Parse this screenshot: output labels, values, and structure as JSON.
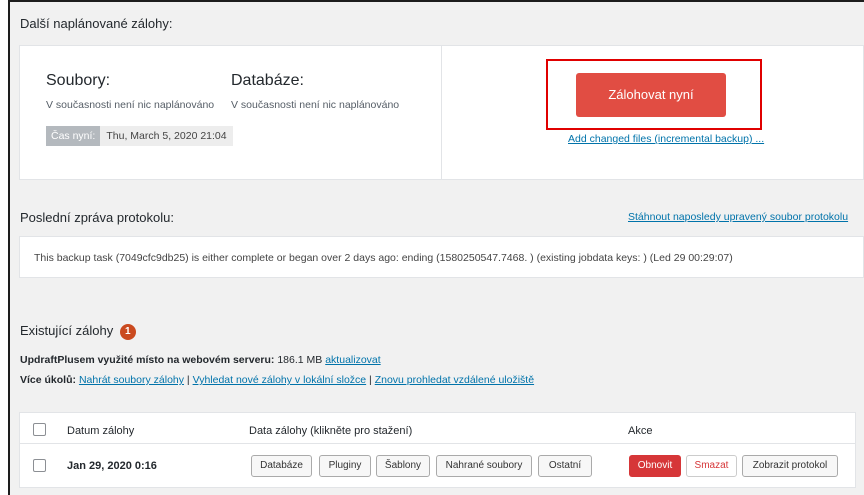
{
  "scheduled": {
    "title": "Další naplánované zálohy:",
    "files_title": "Soubory:",
    "files_status": "V současnosti není nic naplánováno",
    "db_title": "Databáze:",
    "db_status": "V současnosti není nic naplánováno",
    "time_label": "Čas nyní:",
    "time_value": "Thu, March 5, 2020 21:04",
    "backup_now": "Zálohovat nyní",
    "incremental_link": "Add changed files (incremental backup) ..."
  },
  "log": {
    "title": "Poslední zpráva protokolu:",
    "download_link": "Stáhnout naposledy upravený soubor protokolu",
    "message": "This backup task (7049cfc9db25) is either complete or began over 2 days ago: ending (1580250547.7468. ) (existing jobdata keys: ) (Led 29 00:29:07)"
  },
  "existing": {
    "title": "Existující zálohy",
    "count": "1",
    "space_label": "UpdraftPlusem využité místo na webovém serveru:",
    "space_value": "186.1 MB",
    "refresh_link": "aktualizovat",
    "more_tasks_label": "Více úkolů:",
    "task_upload": "Nahrát soubory zálohy",
    "task_find": "Vyhledat nové zálohy v lokální složce",
    "task_rescan": "Znovu prohledat vzdálené uložiště",
    "separator": "|"
  },
  "table": {
    "headers": {
      "date": "Datum zálohy",
      "data": "Data zálohy (klikněte pro stažení)",
      "actions": "Akce"
    },
    "rows": [
      {
        "date": "Jan 29, 2020 0:16",
        "data_buttons": [
          "Databáze",
          "Pluginy",
          "Šablony",
          "Nahrané soubory",
          "Ostatní"
        ],
        "restore": "Obnovit",
        "delete": "Smazat",
        "view_log": "Zobrazit protokol"
      }
    ]
  }
}
